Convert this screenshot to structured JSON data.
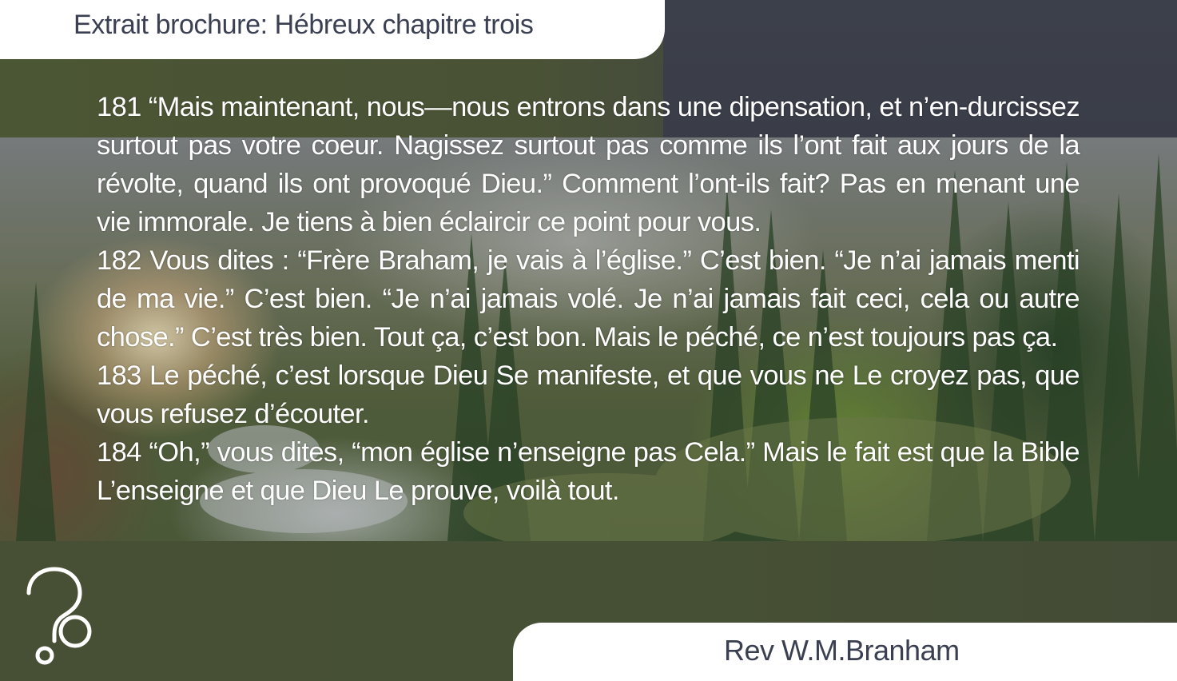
{
  "header": {
    "title": "Extrait brochure: Hébreux chapitre trois"
  },
  "excerpt": {
    "paragraphs": [
      "181 “Mais maintenant, nous—nous entrons dans une dipensation, et n’en-durcissez surtout pas votre coeur. Nagissez surtout pas comme ils l’ont fait aux jours de la révolte, quand ils ont provoqué Dieu.” Comment l’ont-ils fait? Pas en menant une vie immorale. Je tiens à bien éclaircir ce point pour vous.",
      "182 Vous dites : “Frère Braham, je vais à l’église.” C’est bien. “Je n’ai jamais menti de ma vie.” C’est bien. “Je n’ai jamais volé. Je n’ai jamais fait ceci, cela ou autre chose.” C’est très bien. Tout ça, c’est bon. Mais le péché, ce n’est toujours pas ça.",
      "183 Le péché, c’est lorsque Dieu Se manifeste, et que vous ne Le croyez pas, que vous refusez d’écouter.",
      "184 “Oh,” vous dites, “mon église n’enseigne pas Cela.” Mais le fait est que la Bible L’enseigne et que Dieu Le prouve, voilà tout."
    ]
  },
  "footer": {
    "author": "Rev W.M.Branham",
    "logo_icon": "question-mark-logo-icon"
  },
  "colors": {
    "tab_background": "#ffffff",
    "tab_text": "#3a3f52",
    "body_text": "#ffffff",
    "olive_band": "#464f32",
    "slate_band": "#3a3d48"
  }
}
